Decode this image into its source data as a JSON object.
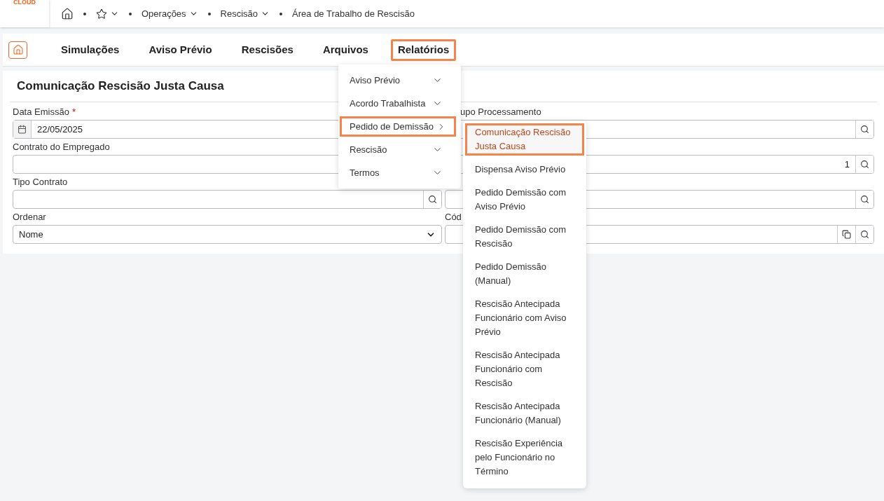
{
  "logo": {
    "text": "CLOUD"
  },
  "breadcrumb": [
    {
      "label": "Operações",
      "dropdown": true
    },
    {
      "label": "Rescisão",
      "dropdown": true
    },
    {
      "label": "Área de Trabalho de Rescisão",
      "dropdown": false
    }
  ],
  "tabs": [
    {
      "label": "Simulações",
      "selected": false
    },
    {
      "label": "Aviso Prévio",
      "selected": false
    },
    {
      "label": "Rescisões",
      "selected": false
    },
    {
      "label": "Arquivos",
      "selected": false
    },
    {
      "label": "Relatórios",
      "selected": true
    }
  ],
  "form": {
    "title": "Comunicação Rescisão Justa Causa",
    "left": [
      {
        "label": "Data Emissão",
        "marker": "*",
        "kind": "date",
        "value": "22/05/2025"
      },
      {
        "label": "Contrato do Empregado",
        "kind": "text"
      },
      {
        "label": "Tipo Contrato",
        "kind": "lookup"
      },
      {
        "label": "Ordenar",
        "kind": "select",
        "value": "Nome"
      }
    ],
    "right": [
      {
        "label": "upo Processamento",
        "label_clipped": true,
        "kind": "lookup"
      },
      {
        "kind": "lookup",
        "value": "1"
      },
      {
        "kind": "lookup"
      },
      {
        "label": "Cód",
        "label_clipped": false,
        "kind": "lookup_copy"
      }
    ]
  },
  "menu": [
    {
      "label": "Aviso Prévio",
      "selected": false
    },
    {
      "label": "Acordo Trabalhista",
      "selected": false
    },
    {
      "label": "Pedido de Demissão",
      "selected": true
    },
    {
      "label": "Rescisão",
      "selected": false
    },
    {
      "label": "Termos",
      "selected": false
    }
  ],
  "submenu": [
    {
      "label": "Comunicação Rescisão Justa Causa",
      "selected": true
    },
    {
      "label": "Dispensa Aviso Prévio",
      "selected": false
    },
    {
      "label": "Pedido Demissão com Aviso Prévio",
      "selected": false
    },
    {
      "label": "Pedido Demissão com Rescisão",
      "selected": false
    },
    {
      "label": "Pedido Demissão (Manual)",
      "selected": false
    },
    {
      "label": "Rescisão Antecipada Funcionário com Aviso Prévio",
      "selected": false
    },
    {
      "label": "Rescisão Antecipada Funcionário com Rescisão",
      "selected": false
    },
    {
      "label": "Rescisão Antecipada Funcionário (Manual)",
      "selected": false
    },
    {
      "label": "Rescisão Experiência pelo Funcionário no Término",
      "selected": false
    }
  ]
}
